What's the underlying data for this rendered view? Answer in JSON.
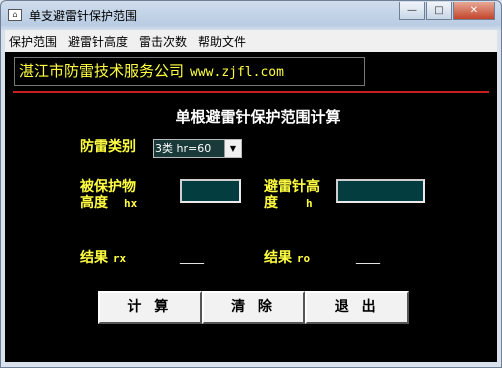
{
  "window": {
    "title": "单支避雷针保护范围",
    "controls": {
      "minimize": "—",
      "maximize": "□",
      "close": "✕"
    }
  },
  "menu": [
    "保护范围",
    "避雷针高度",
    "雷击次数",
    "帮助文件"
  ],
  "company": {
    "name": "湛江市防雷技术服务公司",
    "url": "www.zjfl.com"
  },
  "heading": "单根避雷针保护范围计算",
  "form": {
    "lightning_class_label": "防雷类别",
    "lightning_class_value": "3类 hr=60",
    "protected_height_label_1": "被保护物",
    "protected_height_label_2": "高度",
    "protected_height_unit": "hx",
    "protected_height_value": "",
    "rod_height_label_1": "避雷针高",
    "rod_height_label_2": "度",
    "rod_height_unit": "h",
    "rod_height_value": ""
  },
  "results": {
    "rx_label": "结果",
    "rx_unit": "rx",
    "rx_value": "____",
    "ro_label": "结果",
    "ro_unit": "ro",
    "ro_value": "____"
  },
  "buttons": {
    "calculate": "计 算",
    "clear": "清 除",
    "exit": "退 出"
  },
  "colors": {
    "background": "#000000",
    "label": "#ffff40",
    "divider": "#c42020",
    "input_bg": "#033d40"
  }
}
